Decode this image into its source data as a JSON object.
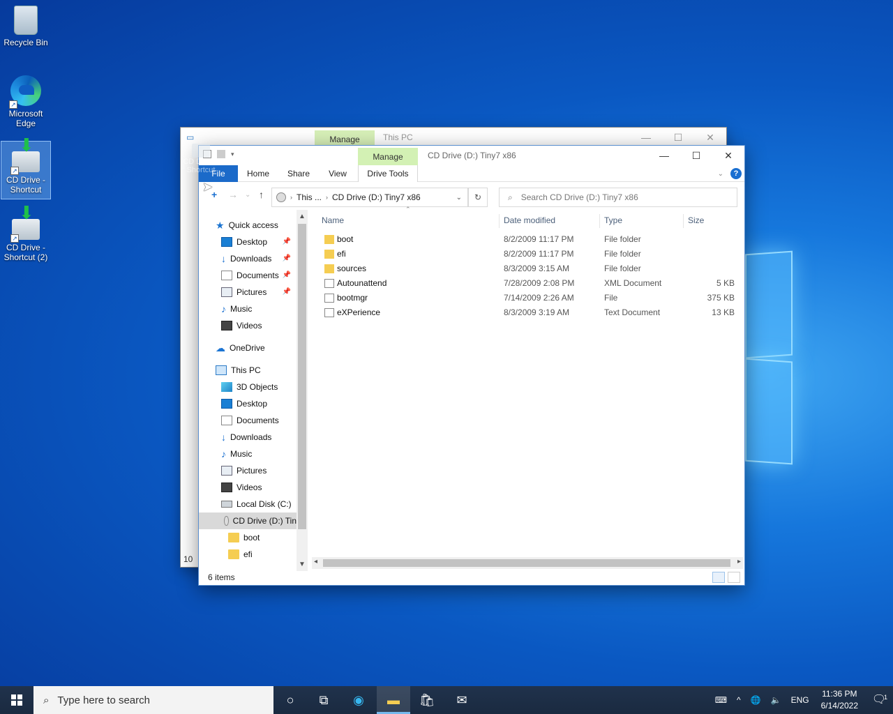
{
  "desktop": {
    "icons": [
      {
        "label": "Recycle Bin"
      },
      {
        "label": "Microsoft Edge"
      },
      {
        "label": "CD Drive - Shortcut"
      },
      {
        "label": "CD Drive - Shortcut (2)"
      }
    ],
    "drag_ghost_label": "CD Drive - Shortcut"
  },
  "back_window": {
    "manage_tab": "Manage",
    "title": "This PC",
    "status_fragment": "10"
  },
  "window": {
    "manage_tab": "Manage",
    "title": "CD Drive (D:) Tiny7 x86",
    "ribbon_tabs": [
      "File",
      "Home",
      "Share",
      "View",
      "Drive Tools"
    ],
    "help": "?",
    "address": {
      "crumbs": [
        "This ...",
        "CD Drive (D:) Tiny7 x86"
      ]
    },
    "search_placeholder": "Search CD Drive (D:) Tiny7 x86",
    "nav": {
      "quick_access": "Quick access",
      "quick_items": [
        "Desktop",
        "Downloads",
        "Documents",
        "Pictures",
        "Music",
        "Videos"
      ],
      "onedrive": "OneDrive",
      "this_pc": "This PC",
      "pc_items": [
        "3D Objects",
        "Desktop",
        "Documents",
        "Downloads",
        "Music",
        "Pictures",
        "Videos",
        "Local Disk (C:)",
        "CD Drive (D:) Tin"
      ],
      "cd_children": [
        "boot",
        "efi"
      ]
    },
    "columns": [
      "Name",
      "Date modified",
      "Type",
      "Size"
    ],
    "files": [
      {
        "name": "boot",
        "date": "8/2/2009 11:17 PM",
        "type": "File folder",
        "size": "",
        "icon": "folder"
      },
      {
        "name": "efi",
        "date": "8/2/2009 11:17 PM",
        "type": "File folder",
        "size": "",
        "icon": "folder"
      },
      {
        "name": "sources",
        "date": "8/3/2009 3:15 AM",
        "type": "File folder",
        "size": "",
        "icon": "folder"
      },
      {
        "name": "Autounattend",
        "date": "7/28/2009 2:08 PM",
        "type": "XML Document",
        "size": "5 KB",
        "icon": "xml"
      },
      {
        "name": "bootmgr",
        "date": "7/14/2009 2:26 AM",
        "type": "File",
        "size": "375 KB",
        "icon": "file"
      },
      {
        "name": "eXPerience",
        "date": "8/3/2009 3:19 AM",
        "type": "Text Document",
        "size": "13 KB",
        "icon": "text"
      }
    ],
    "status": "6 items"
  },
  "taskbar": {
    "search_placeholder": "Type here to search",
    "language": "ENG",
    "time": "11:36 PM",
    "date": "6/14/2022",
    "notification_count": "1"
  },
  "colors": {
    "accent": "#1b6ac9",
    "manage_tab": "#d3f1b4",
    "taskbar": "#1f2f46"
  }
}
